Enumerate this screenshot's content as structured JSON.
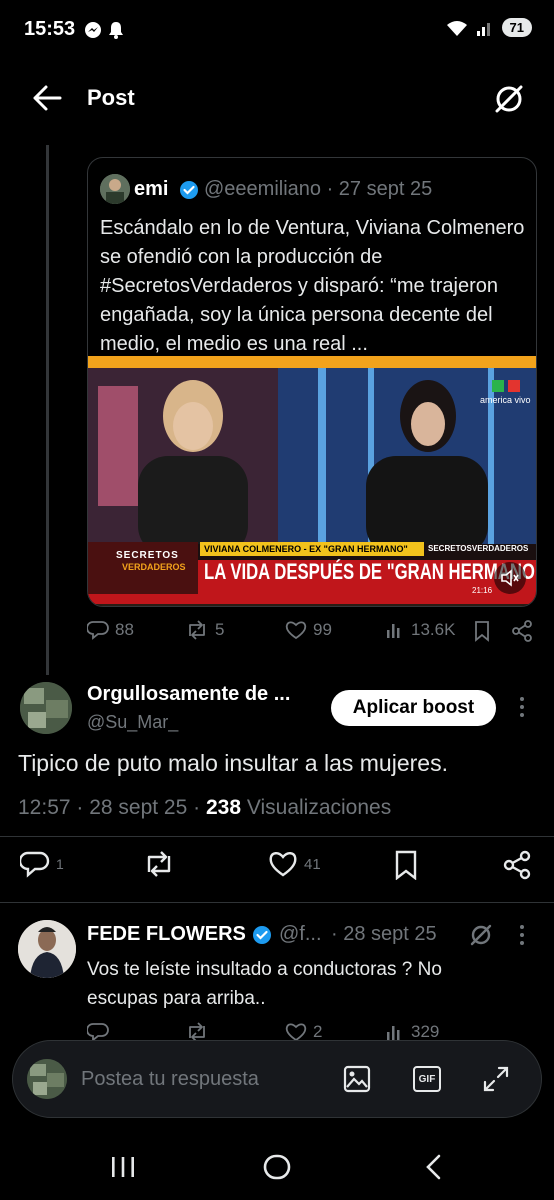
{
  "status_bar": {
    "time": "15:53",
    "battery": "71"
  },
  "header": {
    "title": "Post"
  },
  "quoted_post": {
    "name": "emi",
    "handle_date": "@eeemiliano · 27 sept 25",
    "text": "Escándalo en lo de Ventura, Viviana Colmenero se ofendió con la producción de #SecretosVerdaderos y disparó: “me trajeron engañada, soy la única persona decente del medio, el medio es una real ...",
    "video": {
      "channel_logo": "america vivo",
      "show_logo_1": "SECRETOS",
      "show_logo_2": "VERDADEROS",
      "lower_third_name": "VIVIANA COLMENERO - EX \"GRAN HERMANO\"",
      "lower_third_brand": "SECRETOSVERDADEROS",
      "headline": "LA VIDA DESPUÉS DE \"GRAN HERMANO\"",
      "clock": "21:16"
    }
  },
  "quoted_actions": {
    "replies": "88",
    "reposts": "5",
    "likes": "99",
    "views": "13.6K"
  },
  "main_reply": {
    "name": "Orgullosamente de ...",
    "handle": "@Su_Mar_",
    "boost_label": "Aplicar boost",
    "text": "Tipico de puto malo insultar a las mujeres.",
    "time_date": "12:57 · 28 sept 25 · ",
    "views_count": "238",
    "views_label": " Visualizaciones",
    "replies": "1",
    "likes": "41"
  },
  "second_reply": {
    "name": "FEDE FLOWERS",
    "handle": "@f...",
    "date": "· 28 sept 25",
    "text": "Vos te leíste insultado a conductoras ? No escupas para arriba..",
    "likes": "2",
    "views": "329"
  },
  "composer": {
    "placeholder": "Postea tu respuesta",
    "gif_label": "GIF"
  },
  "colors": {
    "accent": "#1d9bf0",
    "background": "#000000",
    "muted": "#71767b"
  }
}
